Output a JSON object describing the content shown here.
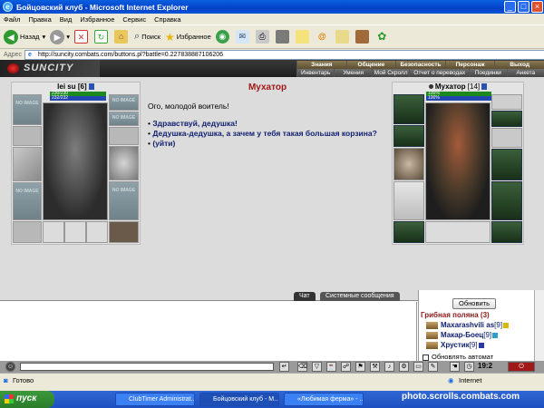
{
  "window": {
    "title": "Бойцовский клуб - Microsoft Internet Explorer"
  },
  "menu": [
    "Файл",
    "Правка",
    "Вид",
    "Избранное",
    "Сервис",
    "Справка"
  ],
  "toolbar": {
    "back": "Назад",
    "search": "Поиск",
    "favorites": "Избранное"
  },
  "address": {
    "label": "Адрес",
    "url": "http://suncity.combats.com/buttons.pl?battle=0.227838887106206"
  },
  "game": {
    "logo": "SUNCITY",
    "nav_top": [
      "Знания",
      "Общение",
      "Безопасность",
      "Персонаж",
      "Выход"
    ],
    "nav_bottom": [
      "Инвентарь",
      "Умения",
      "Мой Скролл",
      "Отчет о переводах",
      "Поединки",
      "Анкета"
    ],
    "player": {
      "name": "lei su",
      "level": "[6]",
      "hp": "230/230",
      "mana": "232/232",
      "noimage": "NO IMAGE"
    },
    "npc": {
      "name": "Мухатор",
      "level": "[14]",
      "hp": "100%",
      "mana": "100%"
    },
    "dialog": {
      "title": "Мухатор",
      "greeting": "Ого, молодой воитель!",
      "options": [
        "Здравствуй, дедушка!",
        "Дедушка-дедушка, а зачем у тебя такая большая корзина?",
        "(уйти)"
      ]
    }
  },
  "chat": {
    "tabs": [
      "Чат",
      "Системные сообщения"
    ],
    "refresh": "Обновить",
    "room": "Грибная поляна (3)",
    "users": [
      {
        "name": "Maxarashvili as",
        "level": "[9]"
      },
      {
        "name": "Макар-Боец",
        "level": "[9]"
      },
      {
        "name": "Хрустик",
        "level": "[9]"
      }
    ],
    "auto": "Обновлять автомат",
    "clock": "19:2"
  },
  "status": {
    "left": "Готово",
    "zone": "Internet"
  },
  "taskbar": {
    "start": "пуск",
    "tasks": [
      "ClubTimer Administrat...",
      "Бойцовский клуб - M...",
      "«Любимая ферма» - ..."
    ]
  },
  "watermark": "photo.scrolls.combats.com"
}
